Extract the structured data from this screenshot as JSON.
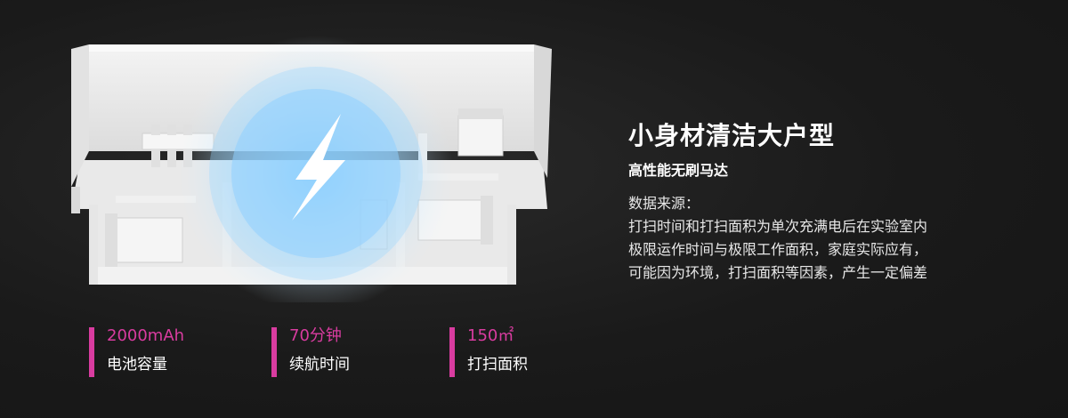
{
  "heading": {
    "title": "小身材清洁大户型",
    "subtitle": "高性能无刷马达"
  },
  "description": {
    "lines": [
      "数据来源：",
      "打扫时间和打扫面积为单次充满电后在实验室内",
      "极限运作时间与极限工作面积，家庭实际应有，",
      "可能因为环境，打扫面积等因素，产生一定偏差"
    ]
  },
  "stats": [
    {
      "value": "2000mAh",
      "label": "电池容量"
    },
    {
      "value": "70分钟",
      "label": "续航时间"
    },
    {
      "value": "150㎡",
      "label": "打扫面积"
    }
  ],
  "colors": {
    "accent": "#d93ca0",
    "background": "#1a1a1a",
    "glow": "#5fc3ff"
  },
  "icons": {
    "center": "lightning-bolt-icon"
  }
}
